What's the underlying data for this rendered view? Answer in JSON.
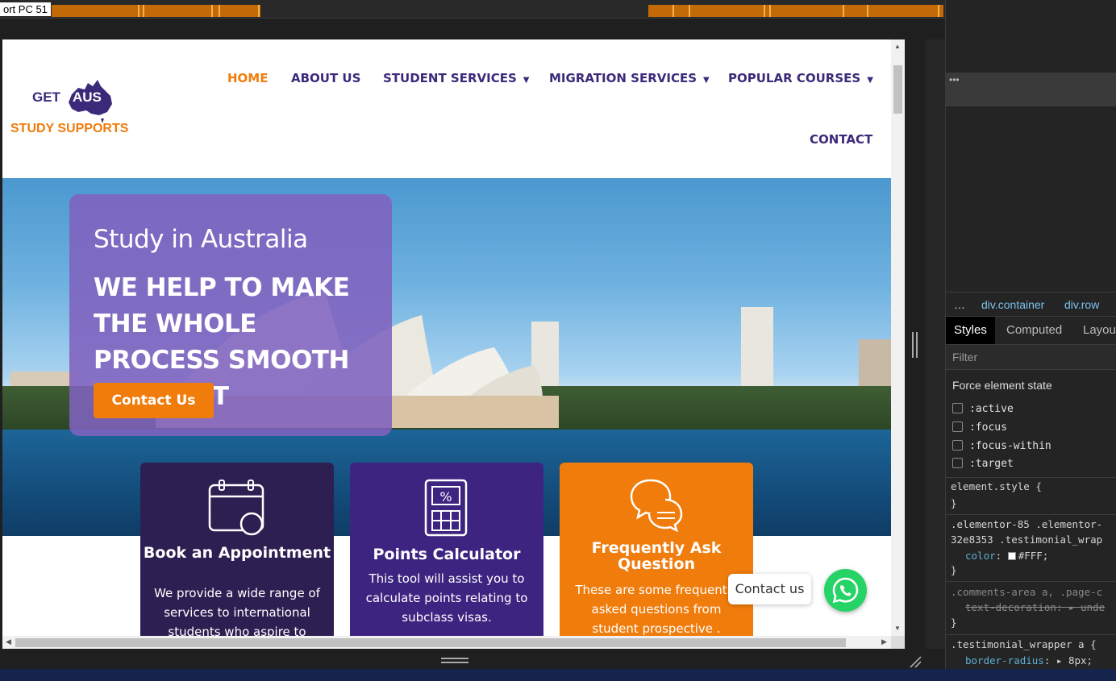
{
  "ruler": {
    "label": "ort PC 51"
  },
  "site": {
    "logo": {
      "get": "GET",
      "aus": "AUS",
      "supports": "STUDY SUPPORTS"
    },
    "nav": [
      {
        "label": "HOME"
      },
      {
        "label": "ABOUT US"
      },
      {
        "label": "STUDENT SERVICES"
      },
      {
        "label": "MIGRATION SERVICES"
      },
      {
        "label": "POPULAR COURSES"
      },
      {
        "label": "CONTACT"
      }
    ],
    "hero": {
      "subtitle": "Study in Australia",
      "headline": "WE HELP TO MAKE THE WHOLE PROCESS SMOOTH AND FAST",
      "button": "Contact Us"
    },
    "cards": [
      {
        "title": "Book an Appointment",
        "desc": "We provide a wide range of services to international students who aspire to",
        "color": "#2e1f52"
      },
      {
        "title": "Points Calculator",
        "desc": "This tool will assist you to calculate points relating to subclass visas.",
        "color": "#3d2480"
      },
      {
        "title": "Frequently Ask Question",
        "desc": "These are some frequently asked questions from student prospective .",
        "color": "#f07c0c"
      }
    ],
    "whatsapp": {
      "label": "Contact us"
    },
    "colors": {
      "brand_purple": "#3b2a7a",
      "brand_orange": "#f07c0c"
    }
  },
  "devtools": {
    "dots": "•••",
    "breadcrumb": [
      "…",
      "div.container",
      "div.row"
    ],
    "tabs": [
      "Styles",
      "Computed",
      "Layout"
    ],
    "filter_placeholder": "Filter",
    "force_state_title": "Force element state",
    "states": [
      ":active",
      ":focus",
      ":focus-within",
      ":target"
    ],
    "rules": {
      "r1_selector": "element.style {",
      "r1_close": "}",
      "r2_selector": ".elementor-85 .elementor-",
      "r2_selector2": "32e8353 .testimonial_wrap",
      "r2_prop": "color",
      "r2_value": "#FFF;",
      "r2_close": "}",
      "r3_selector": ".comments-area a, .page-c",
      "r3_prop": "text-decoration",
      "r3_value": "unde",
      "r3_close": "}",
      "r4_selector": ".testimonial_wrapper a {",
      "r4_prop": "border-radius",
      "r4_value": "8px;"
    }
  }
}
